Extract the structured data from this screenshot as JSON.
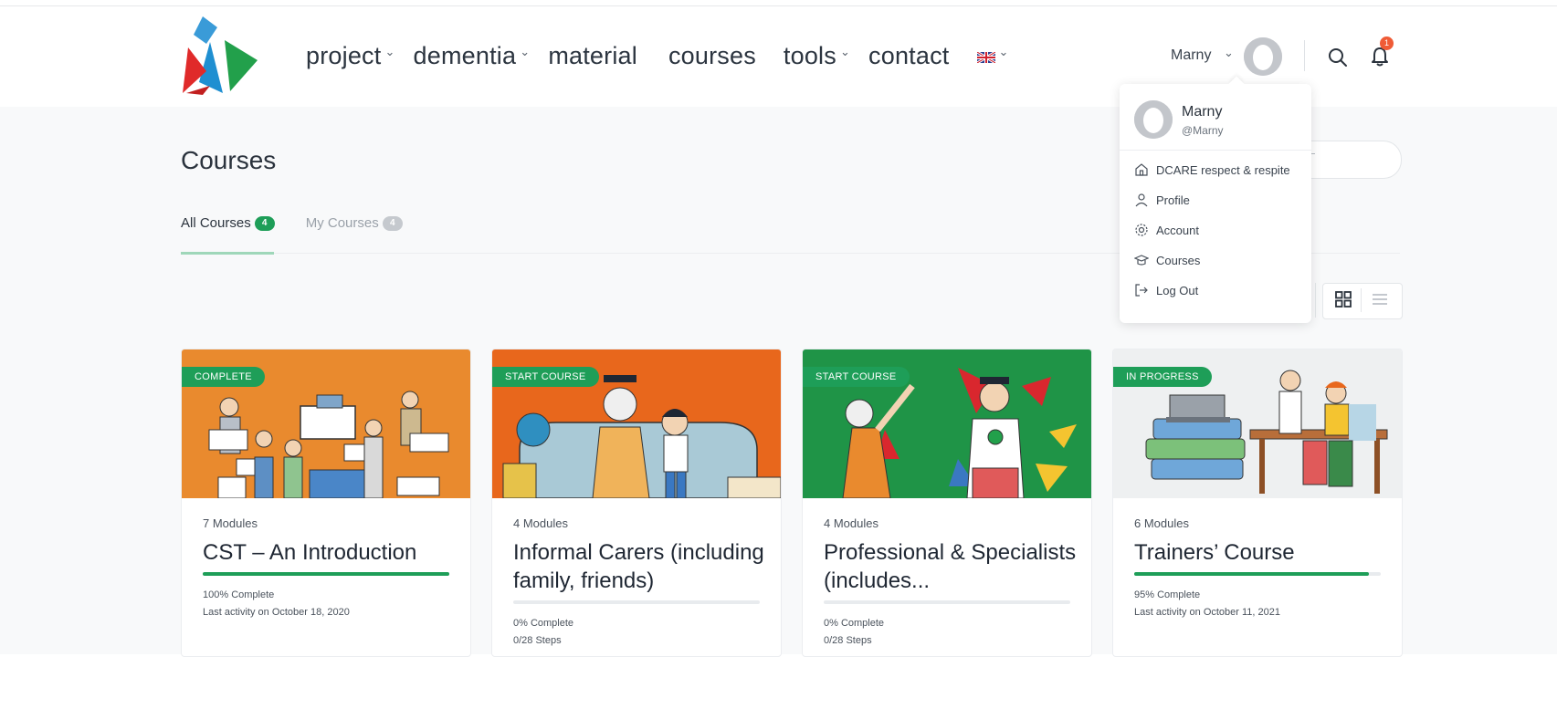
{
  "header": {
    "nav": [
      {
        "label": "project",
        "has_dropdown": true
      },
      {
        "label": "dementia",
        "has_dropdown": true
      },
      {
        "label": "material",
        "has_dropdown": false
      },
      {
        "label": "courses",
        "has_dropdown": false
      },
      {
        "label": "tools",
        "has_dropdown": true
      },
      {
        "label": "contact",
        "has_dropdown": false
      }
    ],
    "language_icon": "uk-flag-icon",
    "user_name": "Marny",
    "notification_count": "1",
    "icons": [
      "logo",
      "user-avatar",
      "search-icon",
      "bell-icon"
    ]
  },
  "page": {
    "title": "Courses",
    "tabs": [
      {
        "label": "All Courses",
        "count": "4",
        "active": true
      },
      {
        "label": "My Courses",
        "count": "4",
        "active": false
      }
    ]
  },
  "view_toggle": {
    "icons": [
      "grid-view-icon",
      "list-view-icon"
    ],
    "active": "grid"
  },
  "dropdown": {
    "name": "Marny",
    "handle": "@Marny",
    "items": [
      {
        "label": "DCARE respect & respite",
        "icon": "home-icon"
      },
      {
        "label": "Profile",
        "icon": "user-icon"
      },
      {
        "label": "Account",
        "icon": "gear-icon"
      },
      {
        "label": "Courses",
        "icon": "graduation-cap-icon"
      },
      {
        "label": "Log Out",
        "icon": "logout-icon"
      }
    ]
  },
  "courses": [
    {
      "status": "COMPLETE",
      "modules": "7 Modules",
      "title": "CST – An Introduction",
      "progress": 1.0,
      "complete_text": "100% Complete",
      "detail": "Last activity on October 18, 2020",
      "thumb_bg": "#e98a2e"
    },
    {
      "status": "START COURSE",
      "modules": "4 Modules",
      "title": "Informal Carers (including family, friends)",
      "progress": 0.0,
      "complete_text": "0% Complete",
      "detail": "0/28 Steps",
      "thumb_bg": "#e8671c"
    },
    {
      "status": "START COURSE",
      "modules": "4 Modules",
      "title": "Professional & Specialists (includes...",
      "progress": 0.0,
      "complete_text": "0% Complete",
      "detail": "0/28 Steps",
      "thumb_bg": "#1f9447"
    },
    {
      "status": "IN PROGRESS",
      "modules": "6 Modules",
      "title": "Trainers’ Course",
      "progress": 0.95,
      "complete_text": "95% Complete",
      "detail": "Last activity on October 11, 2021",
      "thumb_bg": "#eef0f1"
    }
  ],
  "colors": {
    "accent": "#1e9e58",
    "badge": "#ef5b36"
  }
}
